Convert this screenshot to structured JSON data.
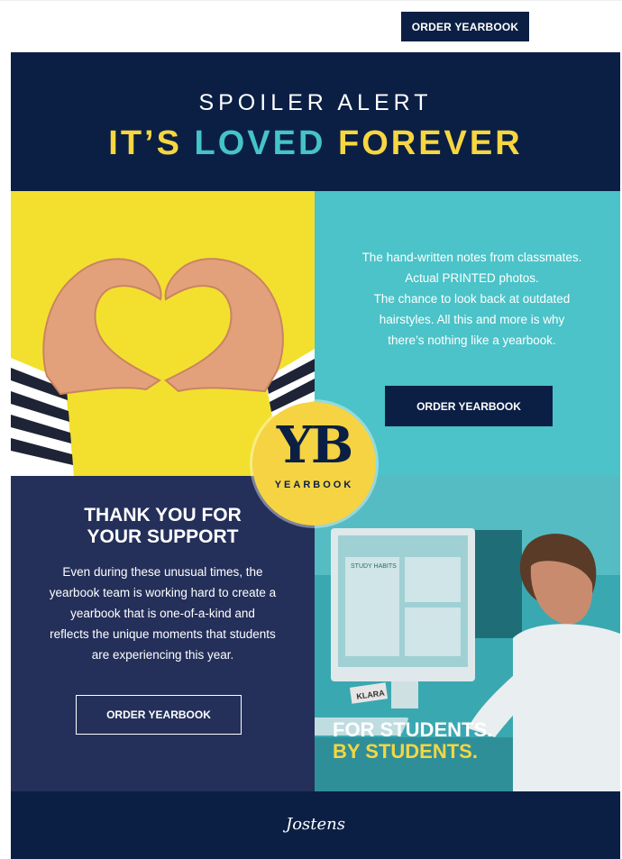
{
  "header": {
    "order_button": "ORDER YEARBOOK"
  },
  "hero": {
    "line1": "SPOILER ALERT",
    "line2_part1": "IT’S",
    "line2_part2": "LOVED",
    "line2_part3": "FOREVER"
  },
  "teal_panel": {
    "lines": [
      "The hand-written notes from classmates.",
      "Actual PRINTED photos.",
      "The chance to look back at outdated",
      "hairstyles. All this and more is why",
      "there’s nothing like a yearbook."
    ],
    "button": "ORDER YEARBOOK"
  },
  "badge": {
    "letters": "YB",
    "word": "YEARBOOK"
  },
  "navy_panel": {
    "title_line1": "THANK YOU FOR",
    "title_line2": "YOUR SUPPORT",
    "body_lines": [
      "Even during these unusual times, the",
      "yearbook team is working hard to create a",
      "yearbook that is one-of-a-kind and",
      "reflects the unique moments that students",
      "are experiencing this year."
    ],
    "button": "ORDER YEARBOOK"
  },
  "photo_panel": {
    "caption_line1": "FOR STUDENTS.",
    "caption_line2": "BY STUDENTS.",
    "screen_text": "STUDY HABITS",
    "nameplate": "KLARA"
  },
  "footer": {
    "logo": "Jostens"
  },
  "colors": {
    "navy": "#0b1f44",
    "yellow": "#f7d640",
    "teal": "#45c3c9",
    "panel_navy": "#24305a"
  }
}
